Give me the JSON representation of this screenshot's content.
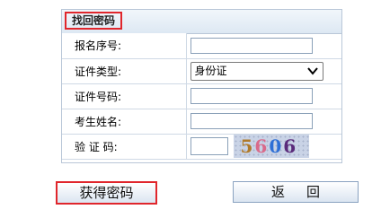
{
  "panel": {
    "title": "找回密码"
  },
  "form": {
    "reg_no_label": "报名序号:",
    "id_type_label": "证件类型:",
    "id_type_value": "身份证",
    "id_no_label": "证件号码:",
    "name_label": "考生姓名:",
    "captcha_label": "验 证 码:",
    "captcha_text": "5606"
  },
  "buttons": {
    "get_password": "获得密码",
    "back": "返回"
  },
  "colors": {
    "highlight": "#e0262c",
    "border": "#b9c7d8"
  }
}
